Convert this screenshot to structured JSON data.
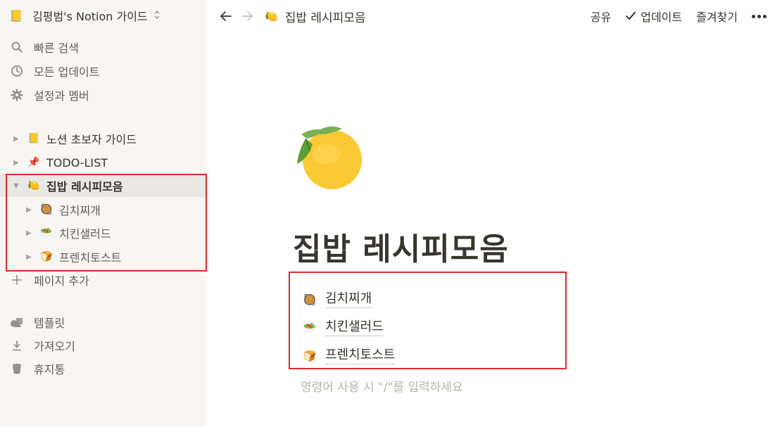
{
  "sidebar": {
    "workspace": {
      "emoji": "📒",
      "name": "김평범's Notion 가이드",
      "chevron": "⌃⌄"
    },
    "nav": [
      {
        "label": "빠른 검색",
        "icon": "search-icon"
      },
      {
        "label": "모든 업데이트",
        "icon": "clock-icon"
      },
      {
        "label": "설정과 멤버",
        "icon": "gear-icon"
      }
    ],
    "pages": [
      {
        "emoji": "📒",
        "label": "노션 초보자 가이드"
      },
      {
        "emoji": "📌",
        "label": "TODO-LIST"
      },
      {
        "emoji": "🍋",
        "label": "집밥 레시피모음"
      }
    ],
    "children": [
      {
        "emoji": "🥘",
        "label": "김치찌개"
      },
      {
        "emoji": "🥗",
        "label": "치킨샐러드"
      },
      {
        "emoji": "🍞",
        "label": "프렌치토스트"
      }
    ],
    "add_page": "페이지 추가",
    "bottom": [
      {
        "label": "템플릿",
        "icon": "template-icon"
      },
      {
        "label": "가져오기",
        "icon": "download-icon"
      },
      {
        "label": "휴지통",
        "icon": "trash-icon"
      }
    ]
  },
  "topbar": {
    "breadcrumb_emoji": "🍋",
    "breadcrumb": "집밥 레시피모음",
    "share": "공유",
    "updates": "업데이트",
    "favorite": "즐겨찾기"
  },
  "page": {
    "icon": "lemon-icon",
    "title": "집밥 레시피모음",
    "subpages": [
      {
        "emoji": "🥘",
        "label": "김치찌개"
      },
      {
        "emoji": "🥗",
        "label": "치킨샐러드"
      },
      {
        "emoji": "🍞",
        "label": "프렌치토스트"
      }
    ],
    "placeholder": "명령어 사용 시 \"/\"를 입력하세요"
  },
  "colors": {
    "sidebar_bg": "#f7f6f3",
    "highlight_box": "#dd2b2b",
    "text": "#37352f",
    "muted": "#91918e"
  }
}
